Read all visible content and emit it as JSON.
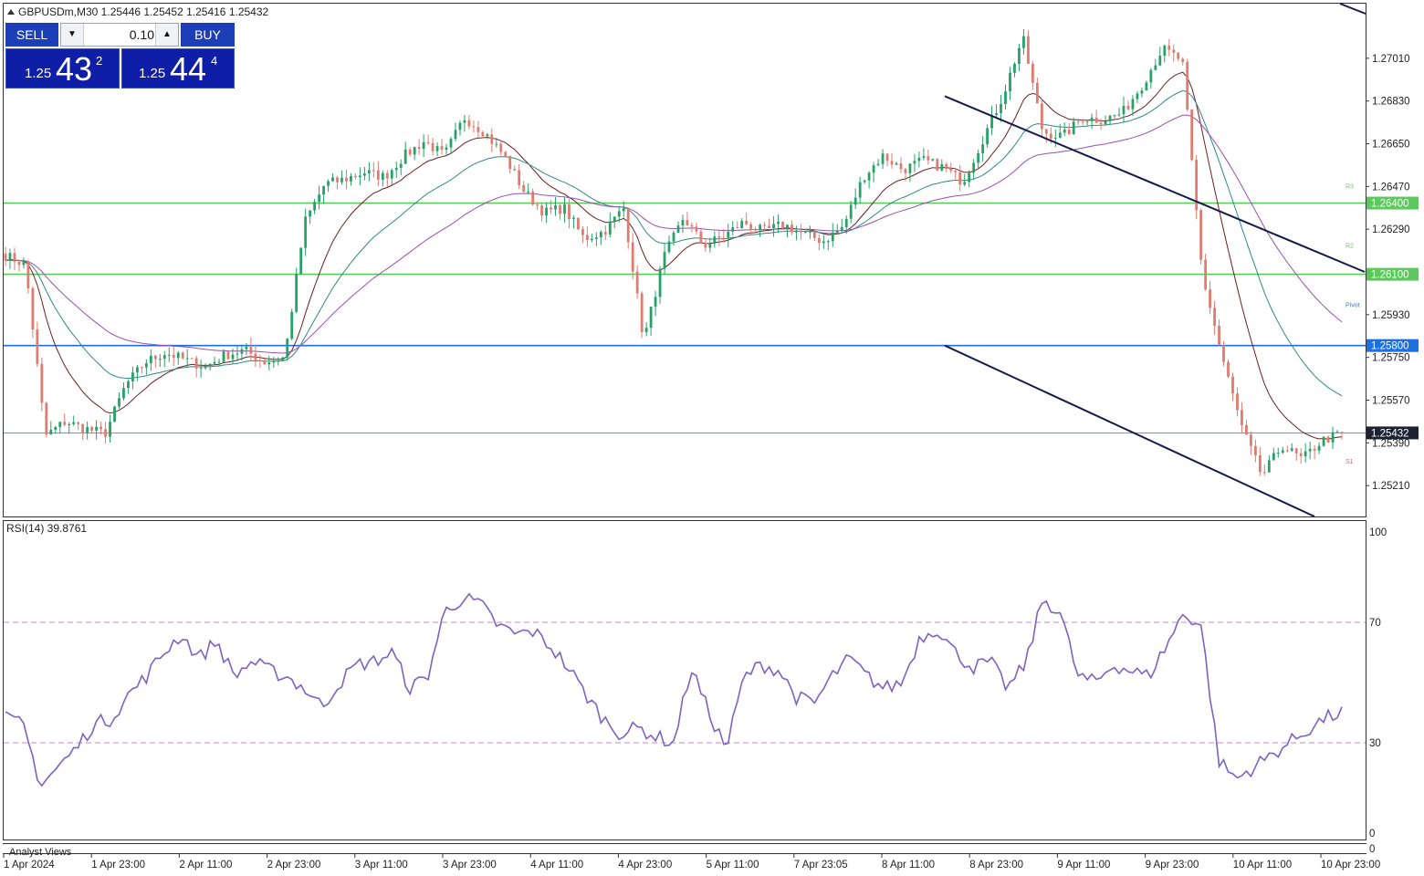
{
  "header": {
    "symbol_line": "GBPUSDm,M30  1.25446 1.25452 1.25416 1.25432"
  },
  "trade_panel": {
    "sell_label": "SELL",
    "buy_label": "BUY",
    "lot_value": "0.10",
    "sell_price": {
      "small": "1.25",
      "big": "43",
      "sup": "2"
    },
    "buy_price": {
      "small": "1.25",
      "big": "44",
      "sup": "4"
    }
  },
  "colors": {
    "bull": "#26a269",
    "bear": "#e07b70",
    "level_green": "#5cc95c",
    "level_blue": "#1e6fe0",
    "channel": "#141a4a",
    "ma_fast": "#6b1f1f",
    "ma_mid": "#2f8a86",
    "ma_slow": "#9b4fb0",
    "rsi_line": "#7d62c2",
    "rsi_level": "#c98ac0",
    "current_label_bg": "#1d2233"
  },
  "chart_data": [
    {
      "type": "candlestick",
      "symbol": "GBPUSDm",
      "timeframe": "M30",
      "ohlc_last": {
        "open": 1.25446,
        "high": 1.25452,
        "low": 1.25416,
        "close": 1.25432
      },
      "ylim": [
        1.2508,
        1.2724
      ],
      "y_ticks": [
        "1.27010",
        "1.26830",
        "1.26650",
        "1.26470",
        "1.26290",
        "1.25930",
        "1.25750",
        "1.25570",
        "1.25390",
        "1.25210"
      ],
      "x_ticks": [
        "1 Apr 2024",
        "1 Apr 23:00",
        "2 Apr 11:00",
        "2 Apr 23:00",
        "3 Apr 11:00",
        "3 Apr 23:00",
        "4 Apr 11:00",
        "4 Apr 23:00",
        "5 Apr 11:00",
        "7 Apr 23:05",
        "8 Apr 11:00",
        "8 Apr 23:00",
        "9 Apr 11:00",
        "9 Apr 23:00",
        "10 Apr 11:00",
        "10 Apr 23:00"
      ],
      "levels": [
        {
          "price": 1.264,
          "label": "1.26400",
          "color": "green"
        },
        {
          "price": 1.261,
          "label": "1.26100",
          "color": "green"
        },
        {
          "price": 1.258,
          "label": "1.25800",
          "color": "blue"
        }
      ],
      "current_price": {
        "price": 1.25432,
        "label": "1.25432"
      },
      "pivot_labels": [
        {
          "text": "R3",
          "price": 1.2647
        },
        {
          "text": "R2",
          "price": 1.2622
        },
        {
          "text": "Pivot",
          "price": 1.2597
        },
        {
          "text": "S1",
          "price": 1.2531
        }
      ],
      "key_closes": [
        1.2618,
        1.2614,
        1.2542,
        1.2548,
        1.2545,
        1.2543,
        1.2563,
        1.2573,
        1.2577,
        1.2574,
        1.2571,
        1.2576,
        1.2578,
        1.2573,
        1.2575,
        1.2632,
        1.2648,
        1.265,
        1.2653,
        1.2651,
        1.266,
        1.2666,
        1.266,
        1.2676,
        1.267,
        1.266,
        1.2645,
        1.2636,
        1.2638,
        1.2625,
        1.2628,
        1.2638,
        1.2582,
        1.2617,
        1.2634,
        1.2622,
        1.2626,
        1.2632,
        1.2628,
        1.2631,
        1.2627,
        1.2624,
        1.263,
        1.2651,
        1.266,
        1.2654,
        1.2658,
        1.2655,
        1.2649,
        1.2667,
        1.2685,
        1.271,
        1.267,
        1.2668,
        1.2676,
        1.2675,
        1.2678,
        1.269,
        1.2705,
        1.27,
        1.261,
        1.2575,
        1.2545,
        1.2525,
        1.2538,
        1.2532,
        1.254,
        1.2543
      ]
    },
    {
      "type": "line",
      "title": "RSI(14) 39.8761",
      "ylim": [
        0,
        100
      ],
      "y_ticks": [
        "100",
        "70",
        "30",
        "0"
      ],
      "levels": [
        70,
        30
      ],
      "key_values": [
        38,
        36,
        16,
        22,
        28,
        36,
        38,
        46,
        52,
        60,
        66,
        58,
        64,
        52,
        57,
        54,
        52,
        48,
        42,
        50,
        56,
        57,
        60,
        48,
        52,
        74,
        78,
        76,
        69,
        66,
        67,
        62,
        55,
        46,
        38,
        33,
        35,
        32,
        30,
        55,
        40,
        28,
        52,
        56,
        54,
        45,
        43,
        52,
        58,
        52,
        48,
        50,
        65,
        68,
        60,
        55,
        57,
        48,
        56,
        78,
        73,
        52,
        50,
        56,
        54,
        52,
        62,
        73,
        69,
        24,
        18,
        22,
        26,
        30,
        34,
        38,
        40
      ]
    }
  ],
  "footer": {
    "analyst_views": "Analyst Views",
    "extra_zero": "0"
  }
}
